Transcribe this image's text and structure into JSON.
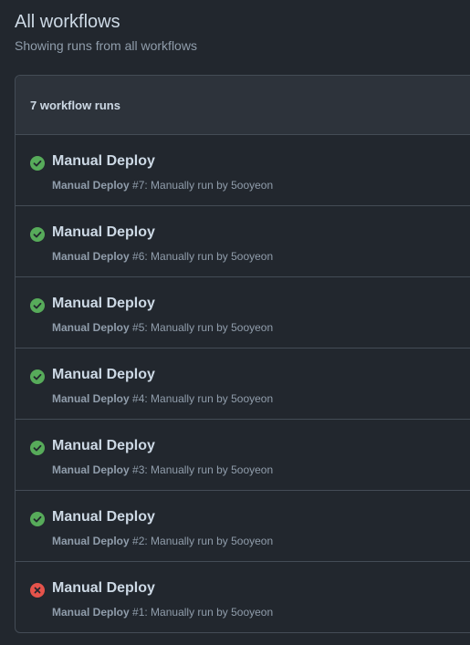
{
  "header": {
    "title": "All workflows",
    "subtitle": "Showing runs from all workflows"
  },
  "runs_box": {
    "count_label": "7 workflow runs"
  },
  "colors": {
    "success": "#57ab5a",
    "failure": "#e5534b"
  },
  "runs": [
    {
      "title": "Manual Deploy",
      "workflow": "Manual Deploy",
      "number": "#7",
      "detail": ": Manually run by 5ooyeon",
      "status": "success"
    },
    {
      "title": "Manual Deploy",
      "workflow": "Manual Deploy",
      "number": "#6",
      "detail": ": Manually run by 5ooyeon",
      "status": "success"
    },
    {
      "title": "Manual Deploy",
      "workflow": "Manual Deploy",
      "number": "#5",
      "detail": ": Manually run by 5ooyeon",
      "status": "success"
    },
    {
      "title": "Manual Deploy",
      "workflow": "Manual Deploy",
      "number": "#4",
      "detail": ": Manually run by 5ooyeon",
      "status": "success"
    },
    {
      "title": "Manual Deploy",
      "workflow": "Manual Deploy",
      "number": "#3",
      "detail": ": Manually run by 5ooyeon",
      "status": "success"
    },
    {
      "title": "Manual Deploy",
      "workflow": "Manual Deploy",
      "number": "#2",
      "detail": ": Manually run by 5ooyeon",
      "status": "success"
    },
    {
      "title": "Manual Deploy",
      "workflow": "Manual Deploy",
      "number": "#1",
      "detail": ": Manually run by 5ooyeon",
      "status": "failure"
    }
  ]
}
